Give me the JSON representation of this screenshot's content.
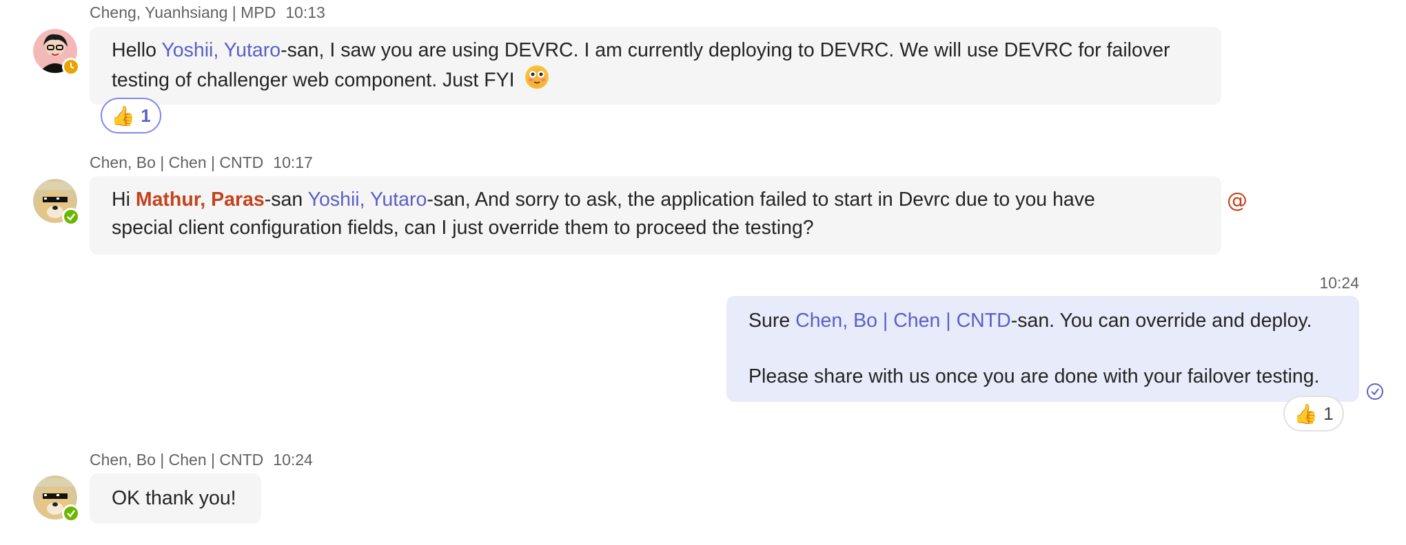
{
  "messages": [
    {
      "sender": "Cheng, Yuanhsiang | MPD",
      "time": "10:13",
      "text_1": "Hello ",
      "mention_1": "Yoshii, Yutaro",
      "text_2": "-san, I saw you are using DEVRC. I am currently deploying to DEVRC. We will use DEVRC for failover",
      "text_3": "testing of challenger web component. Just FYI",
      "emoji": "smiley-face-emoji",
      "reaction_icon": "thumbs-up-icon",
      "reaction_count": "1"
    },
    {
      "sender": "Chen, Bo | Chen | CNTD",
      "time": "10:17",
      "text_1": "Hi ",
      "mention_me": "Mathur, Paras",
      "text_2": "-san ",
      "mention_1": "Yoshii, Yutaro",
      "text_3": "-san, And sorry to ask, the application failed to start in Devrc due to you have",
      "text_4": "special client configuration fields, can I just override them to proceed the testing?",
      "mention_indicator": "@"
    },
    {
      "time": "10:24",
      "text_1": "Sure ",
      "mention_1": "Chen, Bo | Chen | CNTD",
      "text_2": "-san. You can override and deploy.",
      "text_3": "Please share with us once you are done with your failover testing.",
      "read_icon": "read-receipt-icon",
      "reaction_icon": "thumbs-up-icon",
      "reaction_count": "1"
    },
    {
      "sender": "Chen, Bo | Chen | CNTD",
      "time": "10:24",
      "text_1": "OK thank you!"
    }
  ],
  "colors": {
    "mention": "#5b5fc7",
    "mention_me": "#c4421a",
    "bubble_other": "#f5f5f5",
    "bubble_mine": "#e8ebfa",
    "status_available": "#6bb700",
    "status_away": "#eaa300"
  }
}
